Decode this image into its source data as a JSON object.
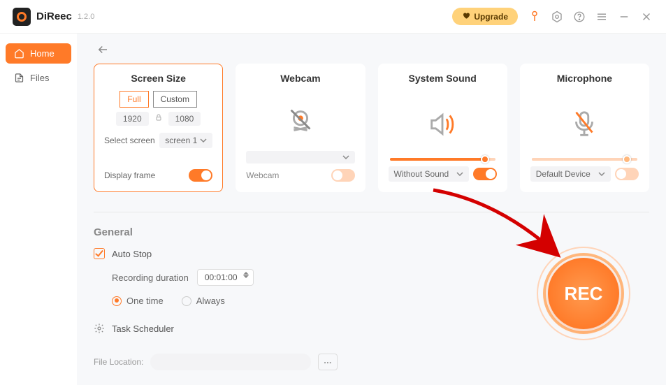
{
  "app": {
    "name": "DiReec",
    "version": "1.2.0"
  },
  "topbar": {
    "upgrade": "Upgrade"
  },
  "nav": {
    "home": "Home",
    "files": "Files"
  },
  "cards": {
    "screen": {
      "title": "Screen Size",
      "full": "Full",
      "custom": "Custom",
      "width": "1920",
      "height": "1080",
      "select_label": "Select screen",
      "select_value": "screen 1",
      "frame_label": "Display frame"
    },
    "webcam": {
      "title": "Webcam",
      "select_value": "",
      "label": "Webcam"
    },
    "sound": {
      "title": "System Sound",
      "select_value": "Without Sound",
      "slider_pct": 90
    },
    "mic": {
      "title": "Microphone",
      "select_value": "Default Device",
      "slider_pct": 90
    }
  },
  "general": {
    "title": "General",
    "auto_stop": "Auto Stop",
    "duration_label": "Recording duration",
    "duration_value": "00:01:00",
    "one_time": "One time",
    "always": "Always",
    "task_scheduler": "Task Scheduler",
    "file_loc_label": "File Location:"
  },
  "rec": {
    "label": "REC"
  }
}
